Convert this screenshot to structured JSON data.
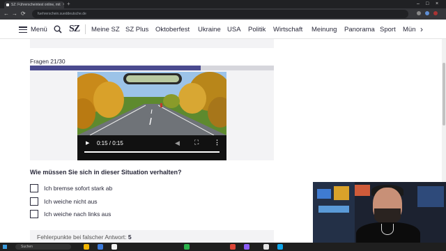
{
  "browser": {
    "tab_title": "SZ: Führerscheintest online, mit",
    "new_tab_glyph": "+",
    "close_tab_glyph": "×",
    "address": "fuehrerschein.sueddeutsche.de",
    "window_controls": [
      "–",
      "□",
      "×"
    ],
    "nav_glyphs": [
      "←",
      "→",
      "⟳"
    ]
  },
  "site_nav": {
    "menu_label": "Menü",
    "logo": "SZ",
    "items": [
      "Meine SZ",
      "SZ Plus",
      "Oktoberfest",
      "Ukraine",
      "USA",
      "Politik",
      "Wirtschaft",
      "Meinung",
      "Panorama",
      "Sport",
      "Mün"
    ],
    "arrow_glyph": "›"
  },
  "quiz": {
    "progress_label": "Fragen 21/30",
    "progress": 0.7,
    "video": {
      "time": "0:15 / 0:15",
      "play_glyph": "▶",
      "volume_glyph": "◀",
      "fullscreen_glyph": "⛶",
      "more_glyph": "⋮"
    },
    "question": "Wie müssen Sie sich in dieser Situation verhalten?",
    "answers": [
      "Ich bremse sofort stark ab",
      "Ich weiche nicht aus",
      "Ich weiche nach links aus"
    ],
    "penalty_label": "Fehlerpunkte bei falscher Antwort:",
    "penalty_value": "5"
  },
  "taskbar": {
    "search_placeholder": "Suchen",
    "app_colors": [
      "#f0b400",
      "#3a78d8",
      "#f2f2f2",
      "#2bb24c",
      "#db4437",
      "#8b5cf6",
      "#e5e5e5",
      "#0ea5e9"
    ]
  },
  "colors": {
    "progress_fill": "#4a4a8f",
    "progress_track": "#d6d6dc",
    "text": "#29293a"
  },
  "icons": {
    "site_search": "search-icon",
    "site_menu": "hamburger-icon",
    "video_play": "play-icon",
    "video_volume": "volume-icon",
    "video_fullscreen": "fullscreen-icon",
    "video_more": "more-vertical-icon"
  }
}
